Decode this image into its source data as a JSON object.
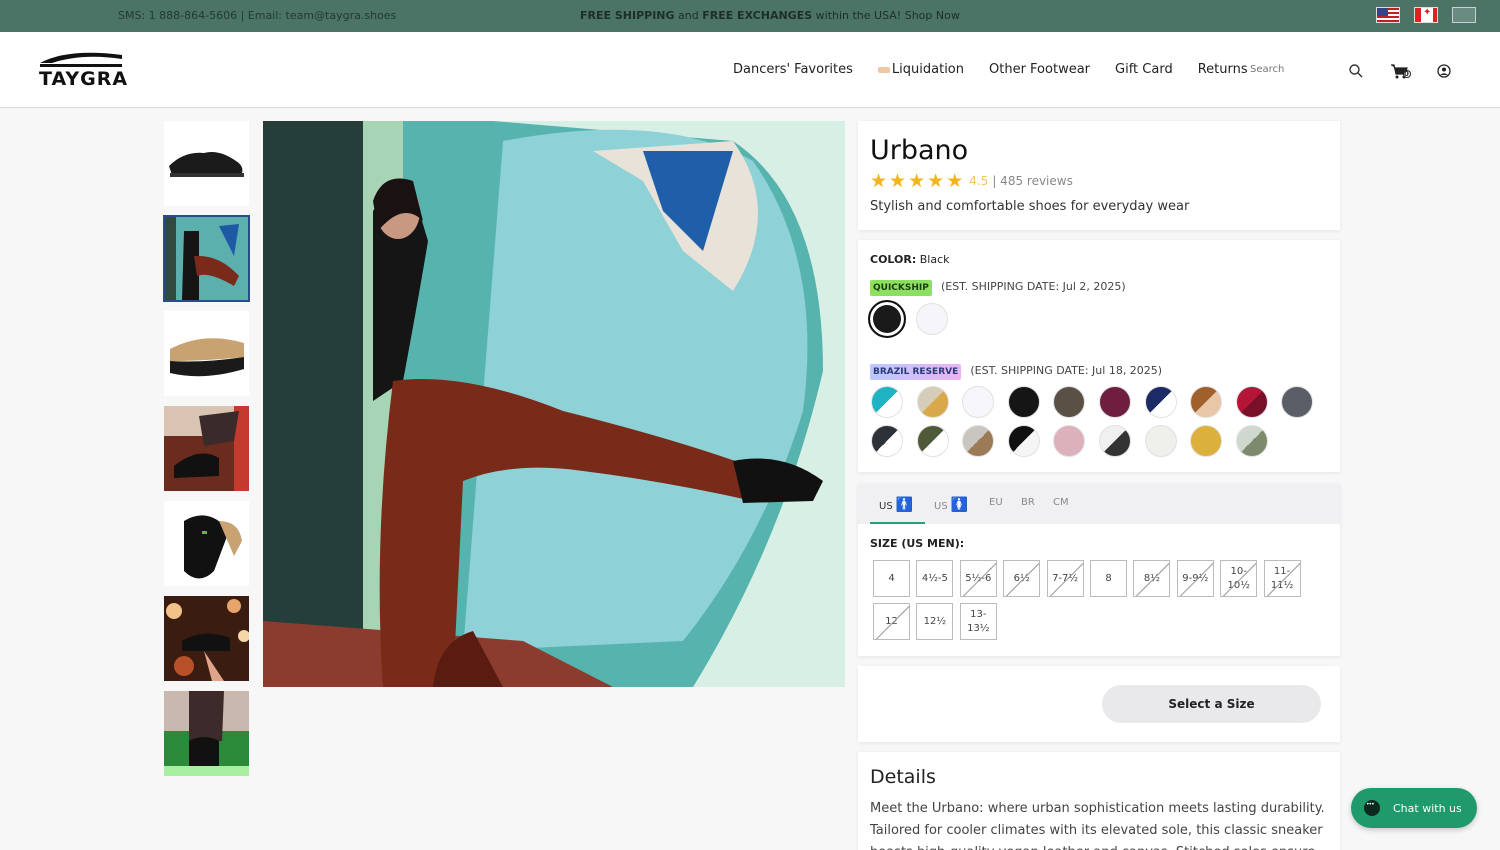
{
  "topbar": {
    "contact": "SMS: 1 888-864-5606 | Email: team@taygra.shoes",
    "promo_bold1": "FREE SHIPPING",
    "promo_mid": " and ",
    "promo_bold2": "FREE EXCHANGES",
    "promo_tail": " within the USA! Shop Now",
    "flags": [
      "us-flag-icon",
      "canada-flag-icon",
      "eu-flag-icon"
    ]
  },
  "header": {
    "logo_text": "TAYGRA",
    "nav": [
      "Dancers' Favorites",
      "Liquidation",
      "Other Footwear",
      "Gift Card",
      "Returns"
    ],
    "search_placeholder": "Search",
    "icons": [
      "search-icon",
      "cart-icon",
      "account-icon"
    ],
    "cart_count": "0"
  },
  "gallery": {
    "thumb_count": 7,
    "selected_index": 1
  },
  "product": {
    "title": "Urbano",
    "rating": "4.5",
    "reviews": "| 485 reviews",
    "subtitle": "Stylish and comfortable shoes for everyday wear"
  },
  "colors": {
    "color_label": "COLOR:",
    "color_value": " Black",
    "quickship_badge": "QUICKSHIP",
    "quickship_date": "(EST. SHIPPING DATE: Jul 2, 2025)",
    "quickship_swatches": [
      "#1a1a1a",
      "#f6f6fa"
    ],
    "brazil_badge": "BRAZIL RESERVE",
    "brazil_date": "(EST. SHIPPING DATE: Jul 18, 2025)",
    "brazil_swatches": [
      "linear-gradient(135deg,#1fb3c3 50%,#fff 50%)",
      "linear-gradient(135deg,#d6cdb8 50%,#d9a84a 50%)",
      "#f7f7fb",
      "#151515",
      "#5b5046",
      "#6e1f3f",
      "linear-gradient(135deg,#1c2a66 50%,#fff 50%)",
      "linear-gradient(135deg,#a0602c 50%,#e8c6a8 50%)",
      "linear-gradient(135deg,#b51536 50%,#7a0f2a 50%)",
      "#5a5e66",
      "linear-gradient(135deg,#2d3138 50%,#fff 50%)",
      "linear-gradient(135deg,#4e5a3a 50%,#fff 50%)",
      "linear-gradient(135deg,#c9c6c0 50%,#9c7a55 50%)",
      "linear-gradient(135deg,#111 50%,#f5f5f5 50%)",
      "#ddb1bb",
      "linear-gradient(135deg,#f0f0f0 50%,#333 50%)",
      "#efefeb",
      "#dbb03c",
      "linear-gradient(135deg,#cfd8cf 50%,#7e8a6c 50%)"
    ]
  },
  "sizes": {
    "tabs": [
      "US",
      "US",
      "EU",
      "BR",
      "CM"
    ],
    "label": "SIZE (US MEN):",
    "buttons": [
      {
        "label": "4",
        "available": true
      },
      {
        "label": "4½-5",
        "available": true
      },
      {
        "label": "5½-6",
        "available": false
      },
      {
        "label": "6½",
        "available": false
      },
      {
        "label": "7-7½",
        "available": false
      },
      {
        "label": "8",
        "available": true
      },
      {
        "label": "8½",
        "available": false
      },
      {
        "label": "9-9½",
        "available": false
      },
      {
        "label": "10-10½",
        "available": false
      },
      {
        "label": "11-11½",
        "available": false
      },
      {
        "label": "12",
        "available": false
      },
      {
        "label": "12½",
        "available": true
      },
      {
        "label": "13-13½",
        "available": true
      }
    ]
  },
  "cta": {
    "select_size": "Select a Size"
  },
  "details": {
    "title": "Details",
    "text": "Meet the Urbano: where urban sophistication meets lasting durability. Tailored for cooler climates with its elevated sole, this classic sneaker boasts high-quality vegan leather and canvas. Stitched soles ensure no"
  },
  "chat": {
    "label": "Chat with us"
  }
}
